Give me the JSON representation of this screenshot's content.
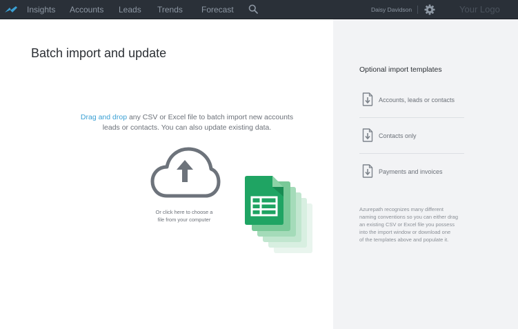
{
  "nav": {
    "items": [
      {
        "label": "Insights"
      },
      {
        "label": "Accounts"
      },
      {
        "label": "Leads"
      },
      {
        "label": "Trends"
      },
      {
        "label": "Forecast"
      }
    ],
    "search_icon": "search-icon",
    "user_name": "Daisy Davidson",
    "settings_icon": "gear-icon",
    "brand_text": "Your Logo",
    "colors": {
      "bar_bg": "#2a3038",
      "nav_text": "#8e98a4"
    }
  },
  "main": {
    "title": "Batch import and update",
    "drop_link": "Drag and drop",
    "drop_text_line1": " any CSV or Excel file to batch import new accounts",
    "drop_text_line2": "leads or contacts. You can also update existing data.",
    "upload_icon": "cloud-upload-icon",
    "click_line1": "Or click here to choose a",
    "click_line2": "file from your computer",
    "sheet_icon": "spreadsheet-icon",
    "colors": {
      "link": "#3aa0d4",
      "sheet_green": "#1fa463"
    }
  },
  "side": {
    "title": "Optional import templates",
    "templates": [
      {
        "label": "Accounts, leads or contacts",
        "icon": "download-file-icon"
      },
      {
        "label": "Contacts only",
        "icon": "download-file-icon"
      },
      {
        "label": "Payments and invoices",
        "icon": "download-file-icon"
      }
    ],
    "note_lines": [
      "Azurepath recognizes many different",
      "naming conventions so you can either drag",
      "an existing CSV or Excel file you possess",
      "into the import window or download one",
      "of the templates above and populate it."
    ]
  }
}
